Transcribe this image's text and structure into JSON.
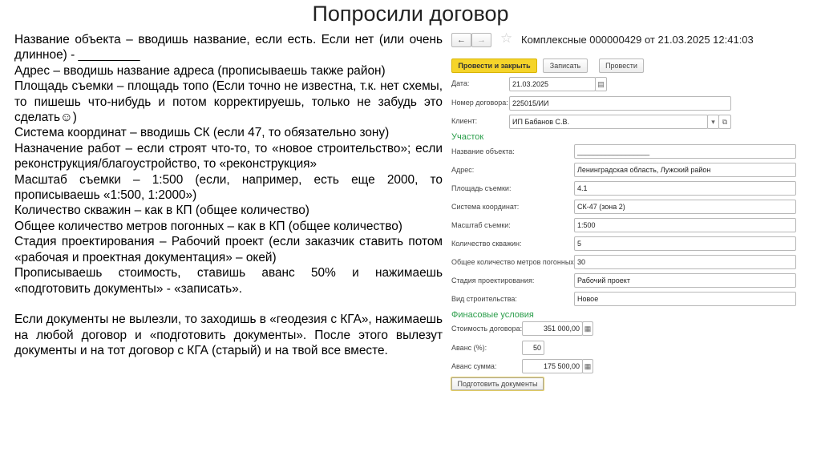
{
  "slide_title": "Попросили договор",
  "instructions": [
    "Название объекта – вводишь название, если есть. Если нет (или очень длинное) - _________",
    "Адрес – вводишь название адреса (прописываешь также район)",
    "Площадь съемки – площадь топо (Если точно не известна, т.к. нет схемы, то пишешь что-нибудь и потом корректируешь, только не забудь это сделать☺)",
    "Система координат – вводишь СК (если 47, то обязательно зону)",
    "Назначение работ – если строят что-то, то «новое строительство»; если реконструкция/благоустройство, то «реконструкция»",
    "Масштаб съемки – 1:500 (если, например, есть еще 2000, то прописываешь «1:500, 1:2000»)",
    "Количество скважин – как в КП (общее количество)",
    "Общее количество метров погонных – как в КП (общее количество)",
    "Стадия проектирования – Рабочий проект (если заказчик ставить потом «рабочая и проектная документация» – окей)",
    "Прописываешь стоимость, ставишь аванс 50% и нажимаешь «подготовить документы» - «записать».",
    "Если документы не вылезли, то заходишь в «геодезия с КГА», нажимаешь на любой договор и «подготовить документы». После этого вылезут документы и на тот договор с КГА (старый) и на твой все вместе."
  ],
  "form": {
    "title": "Комплексные 000000429 от 21.03.2025 12:41:03",
    "buttons": {
      "post_close": "Провести и закрыть",
      "save": "Записать",
      "post": "Провести",
      "prepare": "Подготовить документы"
    },
    "date_label": "Дата:",
    "date": "21.03.2025",
    "contract_no_label": "Номер договора:",
    "contract_no": "225015/ИИ",
    "client_label": "Клиент:",
    "client": "ИП Бабанов С.В.",
    "section_site": "Участок",
    "site_fields": [
      {
        "label": "Название объекта:",
        "value": "__________________"
      },
      {
        "label": "Адрес:",
        "value": "Ленинградская область, Лужский район"
      },
      {
        "label": "Площадь съемки:",
        "value": "4.1"
      },
      {
        "label": "Система координат:",
        "value": "СК-47 (зона 2)"
      },
      {
        "label": "Масштаб съемки:",
        "value": "1:500"
      },
      {
        "label": "Количество скважин:",
        "value": "5"
      },
      {
        "label": "Общее количество метров погонных:",
        "value": "30"
      },
      {
        "label": "Стадия проектирования:",
        "value": "Рабочий проект"
      },
      {
        "label": "Вид строительства:",
        "value": "Новое"
      }
    ],
    "section_finance": "Финасовые условия",
    "cost_label": "Стоимость договора:",
    "cost": "351 000,00",
    "advance_pct_label": "Аванс (%):",
    "advance_pct": "50",
    "advance_sum_label": "Аванс сумма:",
    "advance_sum": "175 500,00",
    "accent": "#f5d42a"
  }
}
